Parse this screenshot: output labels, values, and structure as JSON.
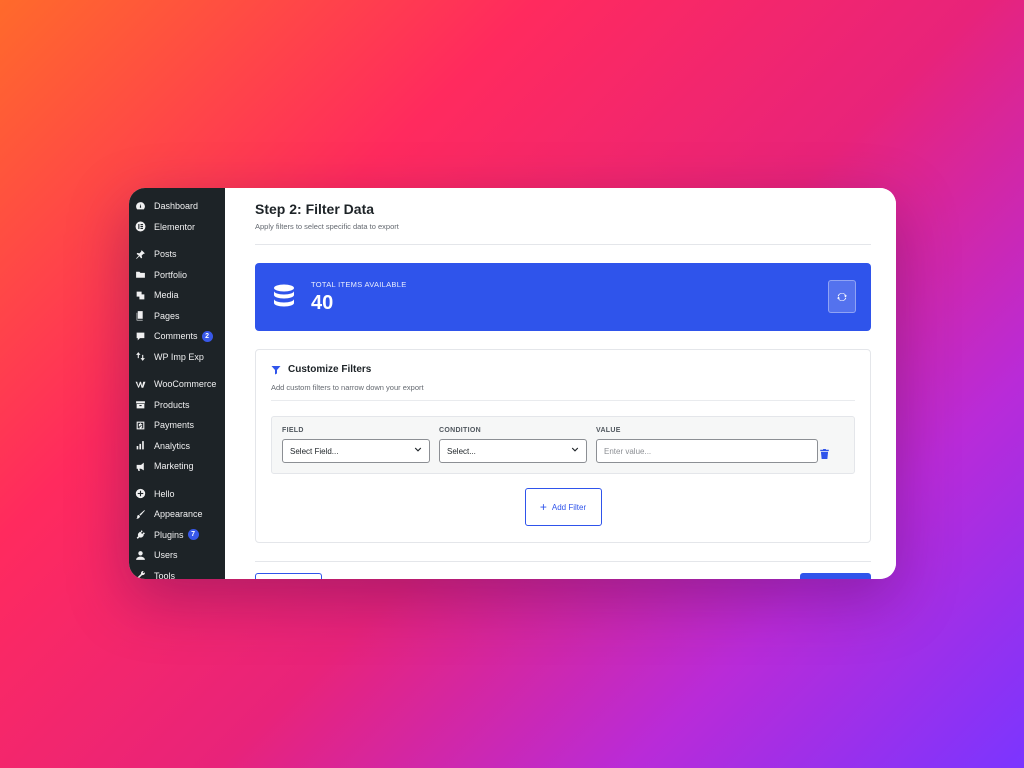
{
  "sidebar": {
    "items": [
      {
        "label": "Dashboard",
        "icon": "dashboard-icon"
      },
      {
        "label": "Elementor",
        "icon": "elementor-icon"
      },
      {
        "label": "Posts",
        "icon": "pin-icon"
      },
      {
        "label": "Portfolio",
        "icon": "folder-icon"
      },
      {
        "label": "Media",
        "icon": "media-icon"
      },
      {
        "label": "Pages",
        "icon": "pages-icon"
      },
      {
        "label": "Comments",
        "icon": "comment-icon",
        "badge": "2"
      },
      {
        "label": "WP Imp Exp",
        "icon": "import-export-icon"
      },
      {
        "label": "WooCommerce",
        "icon": "woocommerce-icon"
      },
      {
        "label": "Products",
        "icon": "products-icon"
      },
      {
        "label": "Payments",
        "icon": "payments-icon"
      },
      {
        "label": "Analytics",
        "icon": "analytics-icon"
      },
      {
        "label": "Marketing",
        "icon": "megaphone-icon"
      },
      {
        "label": "Hello",
        "icon": "plus-circle-icon"
      },
      {
        "label": "Appearance",
        "icon": "brush-icon"
      },
      {
        "label": "Plugins",
        "icon": "plugin-icon",
        "badge": "7"
      },
      {
        "label": "Users",
        "icon": "user-icon"
      },
      {
        "label": "Tools",
        "icon": "wrench-icon"
      }
    ]
  },
  "header": {
    "title": "Step 2: Filter Data",
    "subtitle": "Apply filters to select specific data to export"
  },
  "stats": {
    "label": "TOTAL ITEMS AVAILABLE",
    "value": "40",
    "icon": "database-icon",
    "refresh_icon": "refresh-icon"
  },
  "filters": {
    "title": "Customize Filters",
    "subtitle": "Add custom filters to narrow down your export",
    "icon": "filter-funnel-icon",
    "row": {
      "field_label": "FIELD",
      "field_value": "Select Field...",
      "condition_label": "CONDITION",
      "condition_value": "Select...",
      "value_label": "VALUE",
      "value_placeholder": "Enter value..."
    },
    "add_label": "Add Filter"
  },
  "colors": {
    "accent": "#2f54eb",
    "sidebar_bg": "#1d2327"
  }
}
